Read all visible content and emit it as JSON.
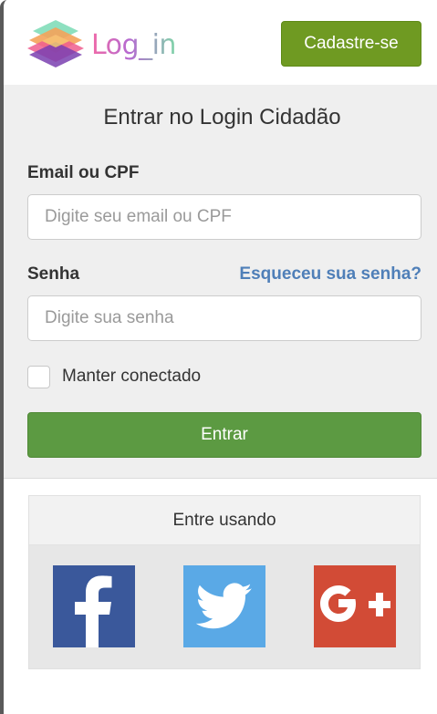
{
  "header": {
    "logo_text": "Log_in",
    "signup_label": "Cadastre-se"
  },
  "login": {
    "title": "Entrar no Login Cidadão",
    "email_label": "Email ou CPF",
    "email_placeholder": "Digite seu email ou CPF",
    "email_value": "",
    "password_label": "Senha",
    "password_placeholder": "Digite sua senha",
    "password_value": "",
    "forgot_label": "Esqueceu sua senha?",
    "remember_label": "Manter conectado",
    "remember_checked": false,
    "submit_label": "Entrar"
  },
  "social": {
    "title": "Entre usando",
    "providers": [
      {
        "name": "facebook",
        "icon": "facebook-icon",
        "color": "#3a589b"
      },
      {
        "name": "twitter",
        "icon": "twitter-icon",
        "color": "#5aa9e6"
      },
      {
        "name": "google-plus",
        "icon": "google-plus-icon",
        "color": "#d24b36"
      }
    ]
  },
  "colors": {
    "signup_button": "#6f9a22",
    "submit_button": "#5c9a42",
    "link": "#4f7fb8",
    "panel_background": "#efefef"
  }
}
